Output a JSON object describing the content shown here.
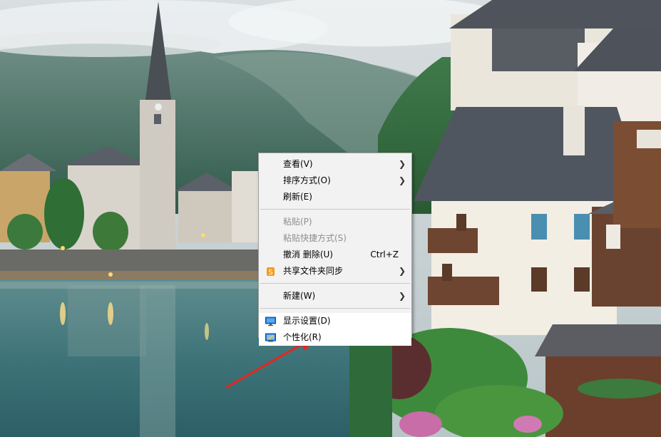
{
  "menu": {
    "groups": [
      [
        {
          "label": "查看(V)",
          "submenu": true
        },
        {
          "label": "排序方式(O)",
          "submenu": true
        },
        {
          "label": "刷新(E)"
        }
      ],
      [
        {
          "label": "粘贴(P)",
          "disabled": true
        },
        {
          "label": "粘贴快捷方式(S)",
          "disabled": true
        },
        {
          "label": "撤消 删除(U)",
          "shortcut": "Ctrl+Z"
        },
        {
          "label": "共享文件夹同步",
          "submenu": true,
          "icon": "sync-icon"
        }
      ],
      [
        {
          "label": "新建(W)",
          "submenu": true
        }
      ],
      [
        {
          "label": "显示设置(D)",
          "icon": "display-icon",
          "highlighted": true
        },
        {
          "label": "个性化(R)",
          "icon": "personalize-icon",
          "highlighted": true
        }
      ]
    ]
  },
  "colors": {
    "annotation_arrow": "#e8261c",
    "menu_background": "#f2f2f2"
  },
  "icons": {
    "submenu": "chevron-right-icon"
  }
}
